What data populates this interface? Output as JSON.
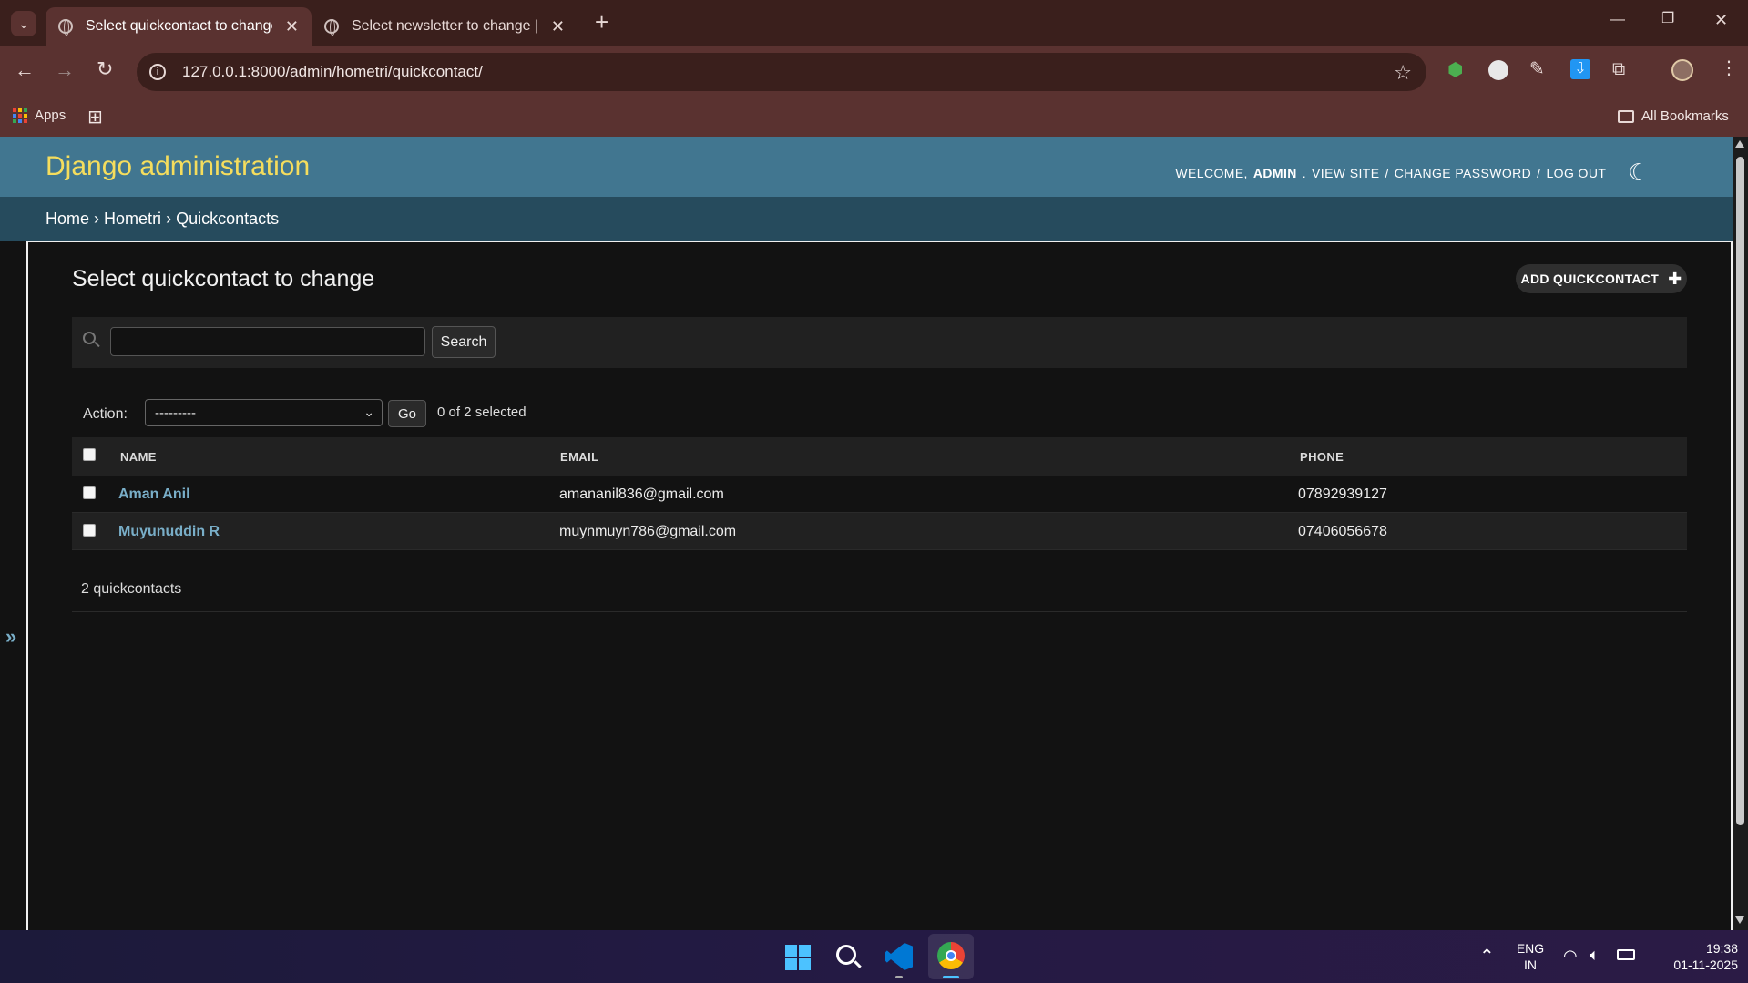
{
  "browser": {
    "tabs": [
      {
        "title": "Select quickcontact to change |",
        "active": true
      },
      {
        "title": "Select newsletter to change | Dj",
        "active": false
      }
    ],
    "new_tab": "+",
    "url": "127.0.0.1:8000/admin/hometri/quickcontact/",
    "bookmarks": {
      "apps_label": "Apps",
      "all_bookmarks": "All Bookmarks"
    },
    "window_controls": {
      "minimize": "—",
      "restore": "❐",
      "close": "✕"
    }
  },
  "header": {
    "branding": "Django administration",
    "welcome": "WELCOME,",
    "user": "ADMIN",
    "view_site": "VIEW SITE",
    "change_password": "CHANGE PASSWORD",
    "log_out": "LOG OUT",
    "sep": "/"
  },
  "breadcrumbs": [
    "Home",
    "Hometri",
    "Quickcontacts"
  ],
  "breadcrumb_sep": "›",
  "content": {
    "title": "Select quickcontact to change",
    "add_button": "ADD QUICKCONTACT",
    "search_button": "Search",
    "search_value": "",
    "action_label": "Action:",
    "action_selected": "---------",
    "go_button": "Go",
    "selected_count": "0 of 2 selected",
    "columns": {
      "name": "NAME",
      "email": "EMAIL",
      "phone": "PHONE"
    },
    "rows": [
      {
        "name": "Aman Anil",
        "email": "amananil836@gmail.com",
        "phone": "07892939127"
      },
      {
        "name": "Muyunuddin R",
        "email": "muynmuyn786@gmail.com",
        "phone": "07406056678"
      }
    ],
    "paginator": "2 quickcontacts",
    "sidebar_toggle": "»"
  },
  "taskbar": {
    "lang_top": "ENG",
    "lang_bottom": "IN",
    "time": "19:38",
    "date": "01-11-2025"
  },
  "colors": {
    "header_bg": "#417690",
    "branding": "#f5dd5d",
    "breadcrumbs_bg": "#264b5d",
    "link": "#79aec8",
    "browser_frame": "#5a3230"
  }
}
